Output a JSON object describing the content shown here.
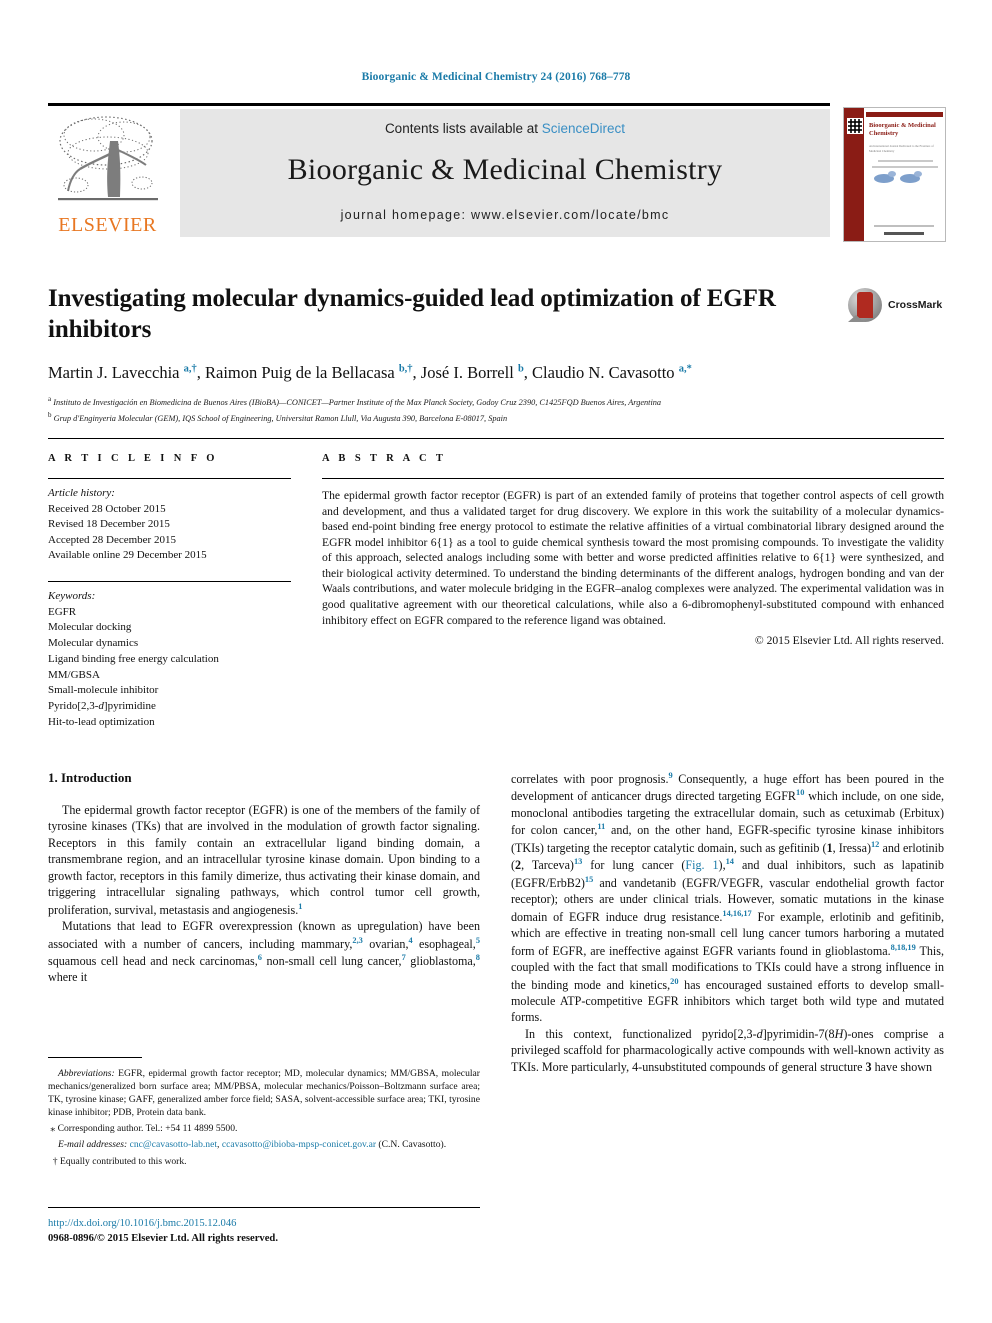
{
  "running_head": "Bioorganic & Medicinal Chemistry 24 (2016) 768–778",
  "masthead": {
    "contents_prefix": "Contents lists available at ",
    "sciencedirect": "ScienceDirect",
    "journal_title": "Bioorganic & Medicinal Chemistry",
    "homepage": "journal homepage: www.elsevier.com/locate/bmc",
    "publisher_wordmark": "ELSEVIER",
    "publisher_logo_icon": "elsevier-tree-icon",
    "cover_title": "Bioorganic & Medicinal Chemistry",
    "cover_subtitle": "An International Journal Dedicated to the Frontiers of Medicinal Chemistry",
    "colors": {
      "link_blue": "#3a8fc4",
      "running_head_blue": "#1b7ba8",
      "elsevier_orange": "#e87722",
      "panel_grey": "#e6e6e6",
      "cover_maroon": "#8a1c15"
    }
  },
  "title": {
    "text": "Investigating molecular dynamics-guided lead optimization of EGFR inhibitors",
    "crossmark_label": "CrossMark",
    "crossmark_icon": "crossmark-icon"
  },
  "authors": {
    "line": "Martin J. Lavecchia a,†, Raimon Puig de la Bellacasa b,†, José I. Borrell b, Claudio N. Cavasotto a,*",
    "list": [
      {
        "name": "Martin J. Lavecchia",
        "marks": "a,†"
      },
      {
        "name": "Raimon Puig de la Bellacasa",
        "marks": "b,†"
      },
      {
        "name": "José I. Borrell",
        "marks": "b"
      },
      {
        "name": "Claudio N. Cavasotto",
        "marks": "a,*"
      }
    ],
    "affiliations": [
      {
        "mark": "a",
        "text": "Instituto de Investigación en Biomedicina de Buenos Aires (IBioBA)—CONICET—Partner Institute of the Max Planck Society, Godoy Cruz 2390, C1425FQD Buenos Aires, Argentina"
      },
      {
        "mark": "b",
        "text": "Grup d'Enginyeria Molecular (GEM), IQS School of Engineering, Universitat Ramon Llull, Via Augusta 390, Barcelona E-08017, Spain"
      }
    ]
  },
  "article_info": {
    "heading": "A R T I C L E   I N F O",
    "history_label": "Article history:",
    "history": [
      "Received 28 October 2015",
      "Revised 18 December 2015",
      "Accepted 28 December 2015",
      "Available online 29 December 2015"
    ],
    "keywords_label": "Keywords:",
    "keywords": [
      "EGFR",
      "Molecular docking",
      "Molecular dynamics",
      "Ligand binding free energy calculation",
      "MM/GBSA",
      "Small-molecule inhibitor",
      "Pyrido[2,3-d]pyrimidine",
      "Hit-to-lead optimization"
    ]
  },
  "abstract": {
    "heading": "A B S T R A C T",
    "text": "The epidermal growth factor receptor (EGFR) is part of an extended family of proteins that together control aspects of cell growth and development, and thus a validated target for drug discovery. We explore in this work the suitability of a molecular dynamics-based end-point binding free energy protocol to estimate the relative affinities of a virtual combinatorial library designed around the EGFR model inhibitor 6{1} as a tool to guide chemical synthesis toward the most promising compounds. To investigate the validity of this approach, selected analogs including some with better and worse predicted affinities relative to 6{1} were synthesized, and their biological activity determined. To understand the binding determinants of the different analogs, hydrogen bonding and van der Waals contributions, and water molecule bridging in the EGFR–analog complexes were analyzed. The experimental validation was in good qualitative agreement with our theoretical calculations, while also a 6-dibromophenyl-substituted compound with enhanced inhibitory effect on EGFR compared to the reference ligand was obtained.",
    "copyright": "© 2015 Elsevier Ltd. All rights reserved."
  },
  "body": {
    "section_heading": "1. Introduction",
    "left_paragraphs": [
      "The epidermal growth factor receptor (EGFR) is one of the members of the family of tyrosine kinases (TKs) that are involved in the modulation of growth factor signaling. Receptors in this family contain an extracellular ligand binding domain, a transmembrane region, and an intracellular tyrosine kinase domain. Upon binding to a growth factor, receptors in this family dimerize, thus activating their kinase domain, and triggering intracellular signaling pathways, which control tumor cell growth, proliferation, survival, metastasis and angiogenesis.1",
      "Mutations that lead to EGFR overexpression (known as upregulation) have been associated with a number of cancers, including mammary,2,3 ovarian,4 esophageal,5 squamous cell head and neck carcinomas,6 non-small cell lung cancer,7 glioblastoma,8 where it"
    ],
    "right_paragraphs": [
      "correlates with poor prognosis.9 Consequently, a huge effort has been poured in the development of anticancer drugs directed targeting EGFR10 which include, on one side, monoclonal antibodies targeting the extracellular domain, such as cetuximab (Erbitux) for colon cancer,11 and, on the other hand, EGFR-specific tyrosine kinase inhibitors (TKIs) targeting the receptor catalytic domain, such as gefitinib (1, Iressa)12 and erlotinib (2, Tarceva)13 for lung cancer (Fig. 1),14 and dual inhibitors, such as lapatinib (EGFR/ErbB2)15 and vandetanib (EGFR/VEGFR, vascular endothelial growth factor receptor); others are under clinical trials. However, somatic mutations in the kinase domain of EGFR induce drug resistance.14,16,17 For example, erlotinib and gefitinib, which are effective in treating non-small cell lung cancer tumors harboring a mutated form of EGFR, are ineffective against EGFR variants found in glioblastoma.8,18,19 This, coupled with the fact that small modifications to TKIs could have a strong influence in the binding mode and kinetics,20 has encouraged sustained efforts to develop small-molecule ATP-competitive EGFR inhibitors which target both wild type and mutated forms.",
      "In this context, functionalized pyrido[2,3-d]pyrimidin-7(8H)-ones comprise a privileged scaffold for pharmacologically active compounds with well-known activity as TKIs. More particularly, 4-unsubstituted compounds of general structure 3 have shown"
    ],
    "figure_link": "Fig. 1"
  },
  "footnotes": {
    "abbreviations_label": "Abbreviations:",
    "abbreviations_text": "EGFR, epidermal growth factor receptor; MD, molecular dynamics; MM/GBSA, molecular mechanics/generalized born surface area; MM/PBSA, molecular mechanics/Poisson–Boltzmann surface area; TK, tyrosine kinase; GAFF, generalized amber force field; SASA, solvent-accessible surface area; TKI, tyrosine kinase inhibitor; PDB, Protein data bank.",
    "corresponding": "Corresponding author. Tel.: +54 11 4899 5500.",
    "corresponding_mark": "⁎",
    "email_label": "E-mail addresses:",
    "email_1": "cnc@cavasotto-lab.net",
    "email_sep": ", ",
    "email_2": "ccavasotto@ibioba-mpsp-conicet.gov.ar",
    "email_tail": " (C.N. Cavasotto).",
    "equal_mark": "†",
    "equal_contribution": "Equally contributed to this work."
  },
  "footer": {
    "doi": "http://dx.doi.org/10.1016/j.bmc.2015.12.046",
    "issn": "0968-0896/© 2015 Elsevier Ltd. All rights reserved."
  }
}
